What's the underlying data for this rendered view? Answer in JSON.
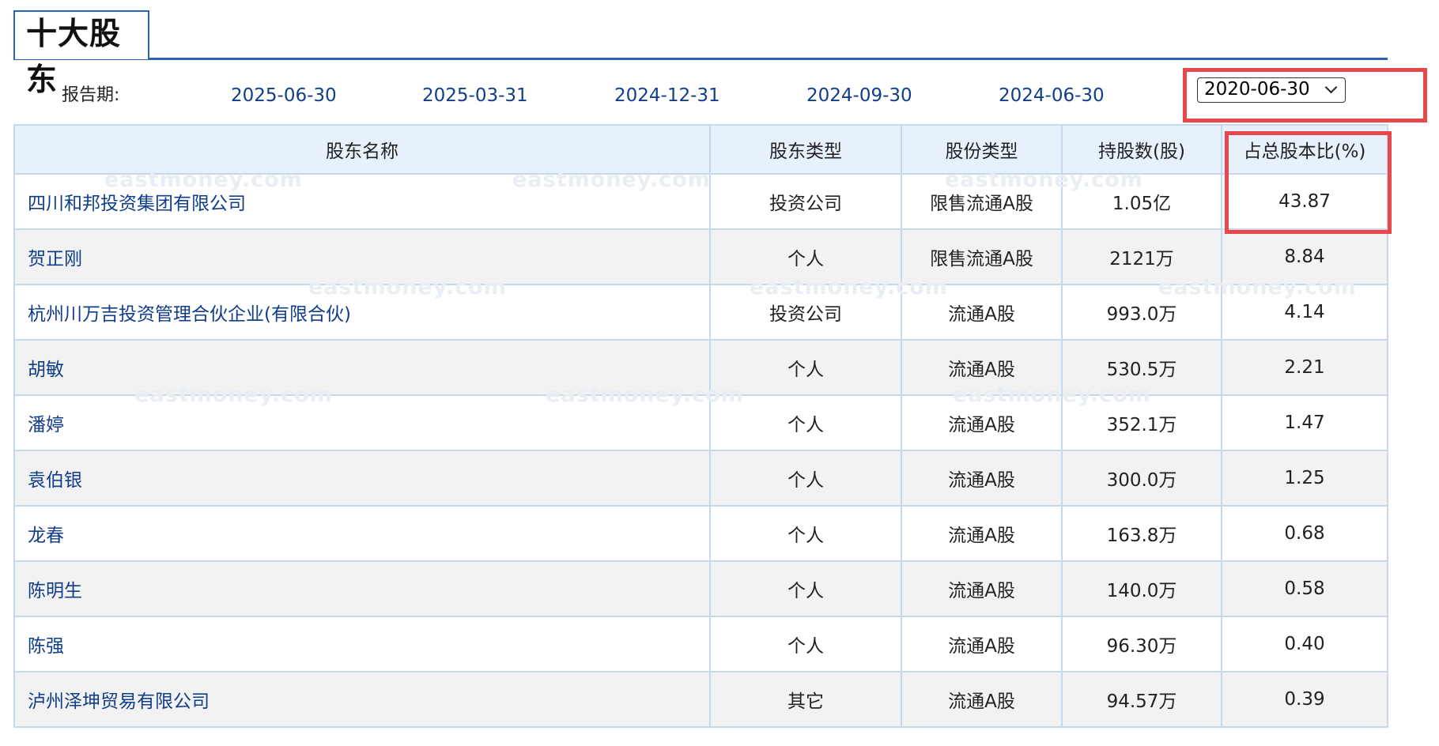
{
  "section": {
    "title": "十大股东"
  },
  "report_period": {
    "label": "报告期:",
    "dates": [
      "2025-06-30",
      "2025-03-31",
      "2024-12-31",
      "2024-09-30",
      "2024-06-30"
    ],
    "selected": "2020-06-30"
  },
  "table": {
    "columns": [
      "股东名称",
      "股东类型",
      "股份类型",
      "持股数(股)",
      "占总股本比(%)"
    ],
    "rows": [
      [
        "四川和邦投资集团有限公司",
        "投资公司",
        "限售流通A股",
        "1.05亿",
        "43.87"
      ],
      [
        "贺正刚",
        "个人",
        "限售流通A股",
        "2121万",
        "8.84"
      ],
      [
        "杭州川万吉投资管理合伙企业(有限合伙)",
        "投资公司",
        "流通A股",
        "993.0万",
        "4.14"
      ],
      [
        "胡敏",
        "个人",
        "流通A股",
        "530.5万",
        "2.21"
      ],
      [
        "潘婷",
        "个人",
        "流通A股",
        "352.1万",
        "1.47"
      ],
      [
        "袁伯银",
        "个人",
        "流通A股",
        "300.0万",
        "1.25"
      ],
      [
        "龙春",
        "个人",
        "流通A股",
        "163.8万",
        "0.68"
      ],
      [
        "陈明生",
        "个人",
        "流通A股",
        "140.0万",
        "0.58"
      ],
      [
        "陈强",
        "个人",
        "流通A股",
        "96.30万",
        "0.40"
      ],
      [
        "泸州泽坤贸易有限公司",
        "其它",
        "流通A股",
        "94.57万",
        "0.39"
      ]
    ]
  },
  "watermark_text": "eastmoney.com",
  "colors": {
    "accent": "#2a62b8",
    "link": "#113e8a",
    "header_bg": "#e7f1fb",
    "row_alt_bg": "#f2f2f2",
    "highlight": "#e8474c"
  }
}
